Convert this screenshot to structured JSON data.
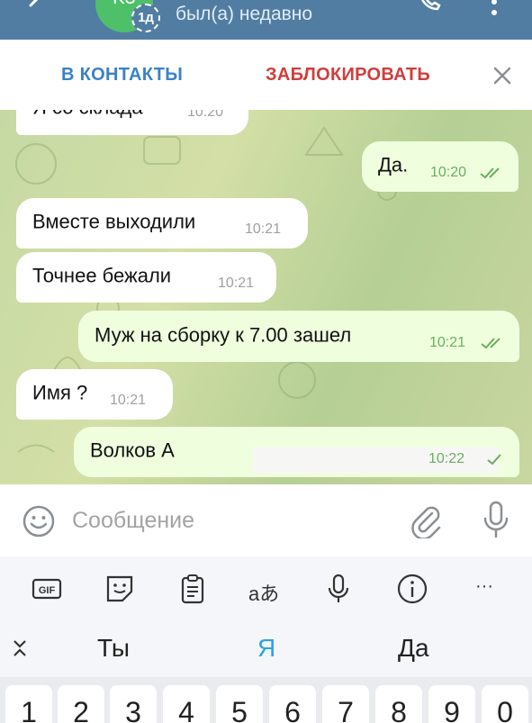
{
  "header": {
    "avatar_initials": "KЗ",
    "story_badge": "1д",
    "status": "был(а) недавно",
    "icons": [
      "back-arrow-icon",
      "phone-icon",
      "more-vert-icon"
    ],
    "header_color": "#517da2"
  },
  "action_bar": {
    "add_contact_label": "В КОНТАКТЫ",
    "block_label": "ЗАБЛОКИРОВАТЬ",
    "close_icon": "close-icon",
    "add_contact_color": "#3a82c4",
    "block_color": "#d13d3d"
  },
  "messages": [
    {
      "direction": "in",
      "text": "Я со склада",
      "time": "10:20"
    },
    {
      "direction": "out",
      "text": "Да.",
      "time": "10:20",
      "status": "read"
    },
    {
      "direction": "in",
      "text": "Вместе выходили",
      "time": "10:21"
    },
    {
      "direction": "in",
      "text": "Точнее бежали",
      "time": "10:21"
    },
    {
      "direction": "out",
      "text": "Муж на сборку к 7.00 зашел",
      "time": "10:21",
      "status": "read"
    },
    {
      "direction": "in",
      "text": "Имя ?",
      "time": "10:21"
    },
    {
      "direction": "out",
      "text": "Волков А",
      "time": "10:22",
      "status": "sent",
      "redacted": true
    }
  ],
  "input": {
    "placeholder": "Сообщение",
    "icons": [
      "emoji-icon",
      "attach-icon",
      "microphone-icon"
    ]
  },
  "keyboard": {
    "toolbar_icons": [
      "gif-icon",
      "sticker-icon",
      "clipboard-icon",
      "translate-icon",
      "voice-input-icon",
      "info-icon",
      "more-horiz-icon"
    ],
    "translate_label": "aあ",
    "more_label": "···",
    "suggestions": [
      "Ты",
      "Я",
      "Да"
    ],
    "number_row": [
      "1",
      "2",
      "3",
      "4",
      "5",
      "6",
      "7",
      "8",
      "9",
      "0"
    ]
  }
}
